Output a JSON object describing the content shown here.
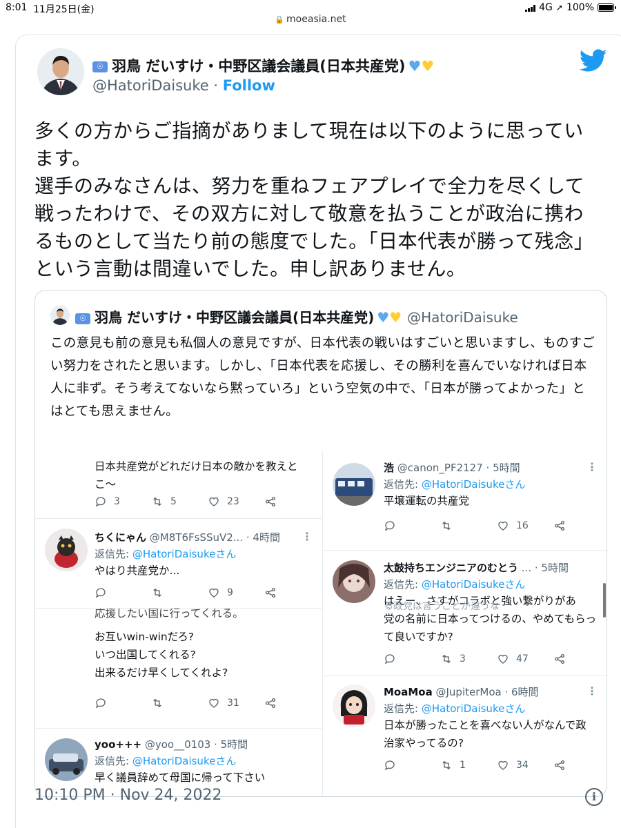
{
  "status_bar": {
    "time": "8:01",
    "date": "11月25日(金)",
    "network": "4G",
    "battery": "100%",
    "battery_level": 1.0
  },
  "browser": {
    "url": "moeasia.net"
  },
  "tweet": {
    "display_name": "羽鳥 だいすけ・中野区議会議員(日本共産党)",
    "flag_emoji": "🇺🇳",
    "hearts": [
      "💙",
      "💛"
    ],
    "handle": "@HatoriDaisuke",
    "separator": "·",
    "follow_label": "Follow",
    "text": "多くの方からご指摘がありまして現在は以下のように思っています。\n選手のみなさんは、努力を重ねフェアプレイで全力を尽くして戦ったわけで、その双方に対して敬意を払うことが政治に携わるものとして当たり前の態度でした。「日本代表が勝って残念」という言動は間違いでした。申し訳ありません。",
    "timestamp": "10:10 PM · Nov 24, 2022"
  },
  "quoted_tweet": {
    "display_name": "羽鳥 だいすけ・中野区議会議員(日本共産党)",
    "handle": "@HatoriDaisuke",
    "text": "この意見も前の意見も私個人の意見ですが、日本代表の戦いはすごいと思いますし、ものすごい努力をされたと思います。しかし、「日本代表を応援し、その勝利を喜んでいなければ日本人に非ず。そう考えてないなら黙っていろ」という空気の中で、「日本が勝ってよかった」とはとても思えません。"
  },
  "replies_left": [
    {
      "text": "日本共産党がどれだけ日本の敵かを教えとこ〜",
      "counts": [
        "3",
        "5",
        "23"
      ]
    },
    {
      "name": "ちくにゃん",
      "meta": "@M8T6FsSSuV2... · 4時間",
      "reply_prefix": "返信先:",
      "reply_to": "@HatoriDaisukeさん",
      "text": "やはり共産党か...",
      "counts": [
        "",
        "",
        "9"
      ]
    },
    {
      "partial_top": "応援したい国に行ってくれる。",
      "text": "お互いwin-winだろ?\nいつ出国してくれる?\n出来るだけ早くしてくれよ?",
      "counts": [
        "",
        "",
        "31"
      ]
    },
    {
      "name": "yoo+++",
      "meta": "@yoo__0103 · 5時間",
      "reply_prefix": "返信先:",
      "reply_to": "@HatoriDaisukeさん",
      "text": "早く議員辞めて母国に帰って下さい"
    }
  ],
  "replies_right": [
    {
      "name": "浩",
      "meta": "@canon_PF2127 · 5時間",
      "reply_prefix": "返信先:",
      "reply_to": "@HatoriDaisukeさん",
      "text": "平壌運転の共産党",
      "counts": [
        "",
        "",
        "16"
      ]
    },
    {
      "name": "太鼓持ちエンジニアのむとう",
      "meta": "... · 5時間",
      "reply_prefix": "返信先:",
      "reply_to": "@HatoriDaisukeさん",
      "text": "はえー、さすがコラボと強い繋がりがあ",
      "overlap_text": "る政党は言うことが違うな",
      "text2": "党の名前に日本ってつけるの、やめてもらって良いですか?",
      "counts": [
        "",
        "3",
        "47"
      ]
    },
    {
      "name": "MoaMoa",
      "meta": "@JupiterMoa · 6時間",
      "reply_prefix": "返信先:",
      "reply_to": "@HatoriDaisukeさん",
      "text": "日本が勝ったことを喜べない人がなんで政治家やってるの?",
      "counts": [
        "",
        "1",
        "34"
      ]
    }
  ]
}
